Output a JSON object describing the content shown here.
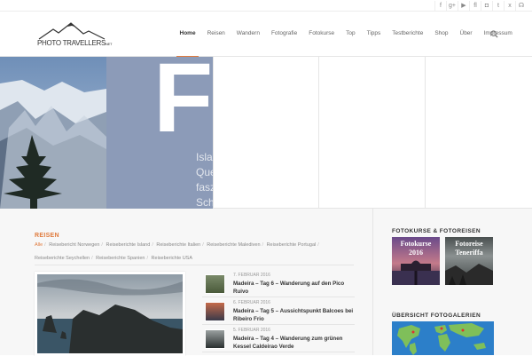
{
  "social_icons": [
    "facebook-icon",
    "google-plus-icon",
    "youtube-icon",
    "flickr-icon",
    "instagram-icon",
    "twitter-icon",
    "xing-icon",
    "rss-icon"
  ],
  "social_glyphs": [
    "f",
    "g+",
    "▶",
    "fl",
    "◘",
    "t",
    "x",
    "☊"
  ],
  "logo": {
    "text": "PHOTO TRAVELLERS",
    "suffix": "NET"
  },
  "nav": [
    "Home",
    "Reisen",
    "Wandern",
    "Fotografie",
    "Fotokurse",
    "Top",
    "Tipps",
    "Testberichte",
    "Shop",
    "Über",
    "Impressum"
  ],
  "hero": {
    "big_letter": "F",
    "lines": [
      "Isla",
      "Que",
      "fasz",
      "Sch"
    ]
  },
  "section": {
    "title": "REISEN",
    "categories": [
      "Alle",
      "Reisebericht Norwegen",
      "Reiseberichte Island",
      "Reiseberichte Italien",
      "Reiseberichte Malediven",
      "Reiseberichte Portugal",
      "Reiseberichte Seychellen",
      "Reiseberichte Spanien",
      "Reiseberichte USA"
    ]
  },
  "posts": [
    {
      "date": "7. FEBRUAR 2016",
      "title": "Madeira – Tag 6 – Wanderung auf den Pico Ruivo"
    },
    {
      "date": "6. FEBRUAR 2016",
      "title": "Madeira – Tag 5 – Aussichtspunkt Balcoes bei Ribeiro Frio"
    },
    {
      "date": "5. FEBRUAR 2016",
      "title": "Madeira – Tag 4 – Wanderung zum grünen Kessel Caldeirao Verde"
    }
  ],
  "sidebar": {
    "title_courses": "FOTOKURSE & FOTOREISEN",
    "promo1": {
      "line1": "Fotokurse",
      "line2": "2016"
    },
    "promo2": {
      "line1": "Fotoreise",
      "line2": "Teneriffa"
    },
    "title_galleries": "ÜBERSICHT FOTOGALERIEN"
  },
  "colors": {
    "accent": "#e07a3c"
  }
}
